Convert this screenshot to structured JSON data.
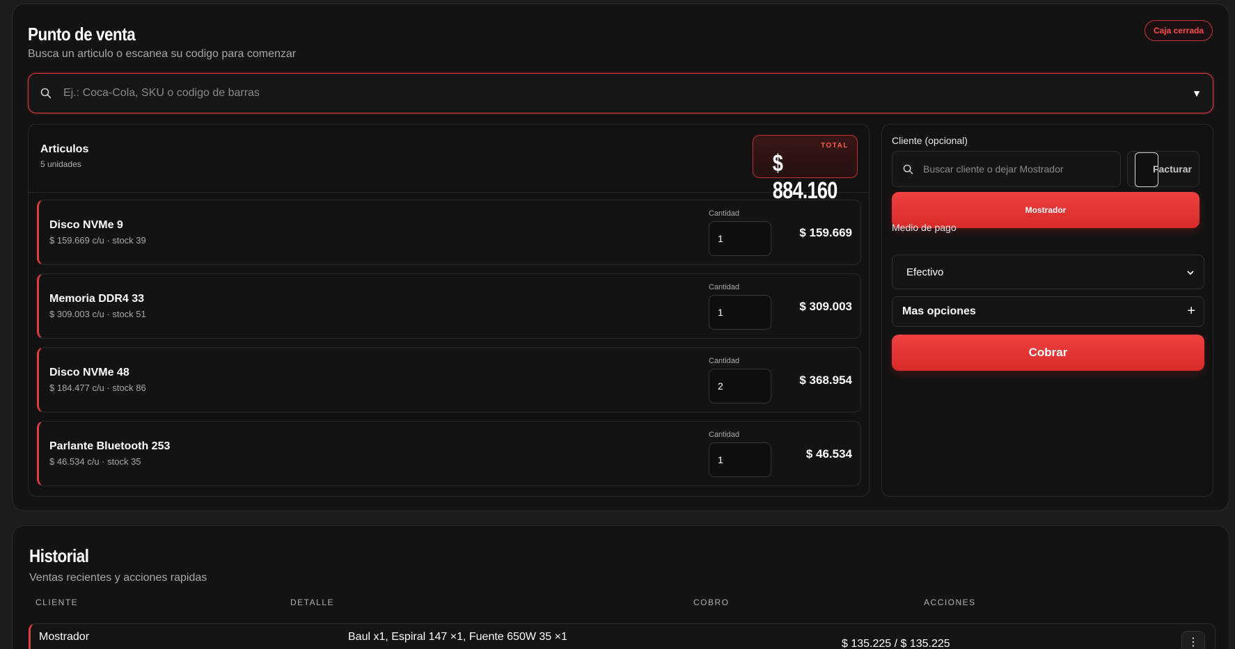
{
  "pos": {
    "title": "Punto de venta",
    "subtitle": "Busca un articulo o escanea su codigo para comenzar",
    "status_badge": "Caja cerrada",
    "search": {
      "placeholder": "Ej.: Coca-Cola, SKU o codigo de barras",
      "icon": "search-icon"
    }
  },
  "articles": {
    "title": "Articulos",
    "count": "5 unidades",
    "total_label": "TOTAL",
    "total_value": "$ 884.160",
    "qty_label": "Cantidad",
    "items": [
      {
        "name": "Disco NVMe 9",
        "meta": "$ 159.669 c/u · stock 39",
        "qty": "1",
        "price": "$ 159.669"
      },
      {
        "name": "Memoria DDR4 33",
        "meta": "$ 309.003 c/u · stock 51",
        "qty": "1",
        "price": "$ 309.003"
      },
      {
        "name": "Disco NVMe 48",
        "meta": "$ 184.477 c/u · stock 86",
        "qty": "2",
        "price": "$ 368.954"
      },
      {
        "name": "Parlante Bluetooth 253",
        "meta": "$ 46.534 c/u · stock 35",
        "qty": "1",
        "price": "$ 46.534"
      }
    ]
  },
  "side": {
    "client_label": "Cliente (opcional)",
    "client_placeholder": "Buscar cliente o dejar Mostrador",
    "facturar_label": "Facturar",
    "mostrador_button": "Mostrador",
    "payment_label": "Medio de pago",
    "payment_value": "Efectivo",
    "more_options": "Mas opciones",
    "more_plus": "+",
    "cobrar_button": "Cobrar"
  },
  "historial": {
    "title": "Historial",
    "subtitle": "Ventas recientes y acciones rapidas",
    "columns": [
      "CLIENTE",
      "DETALLE",
      "COBRO",
      "ACCIONES"
    ],
    "rows": [
      {
        "client": "Mostrador",
        "detail": "Baul x1, Espiral 147 ×1, Fuente 650W 35 ×1",
        "amount": "$ 135.225 / $ 135.225"
      }
    ]
  },
  "colors": {
    "accent": "#e23b3b",
    "background": "#1c1c1c",
    "card": "#131313"
  }
}
